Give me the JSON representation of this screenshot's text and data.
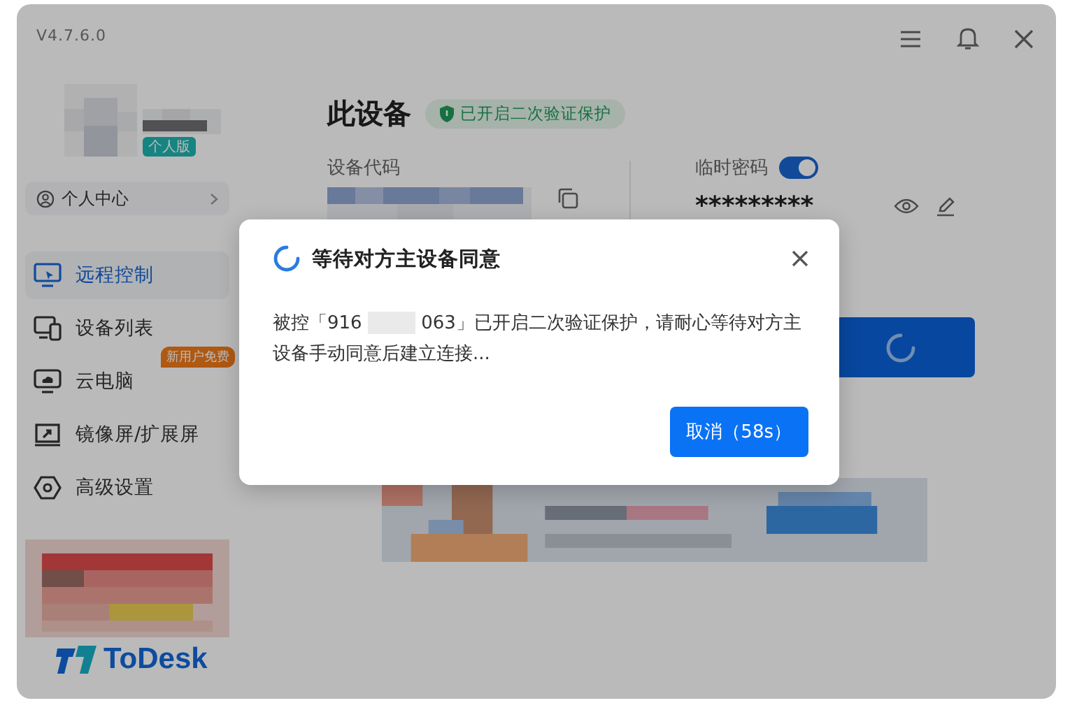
{
  "version": "V4.7.6.0",
  "user": {
    "badge": "个人版"
  },
  "profile_link": "个人中心",
  "nav": [
    {
      "label": "远程控制",
      "selected": true,
      "kind": "remote"
    },
    {
      "label": "设备列表",
      "selected": false,
      "kind": "devices"
    },
    {
      "label": "云电脑",
      "selected": false,
      "kind": "cloud",
      "badge": "新用户免费"
    },
    {
      "label": "镜像屏/扩展屏",
      "selected": false,
      "kind": "mirror"
    },
    {
      "label": "高级设置",
      "selected": false,
      "kind": "settings"
    }
  ],
  "logo": "ToDesk",
  "device": {
    "title": "此设备",
    "security_badge": "已开启二次验证保护",
    "code_label": "设备代码",
    "temp_password": {
      "label": "临时密码",
      "on": true,
      "value": "*********"
    }
  },
  "dialog": {
    "title": "等待对方主设备同意",
    "message_start": "被控「916",
    "message_end": "063」已开启二次验证保护，请耐心等待对方主设备手动同意后建立连接...",
    "cancel": "取消（58s）"
  }
}
